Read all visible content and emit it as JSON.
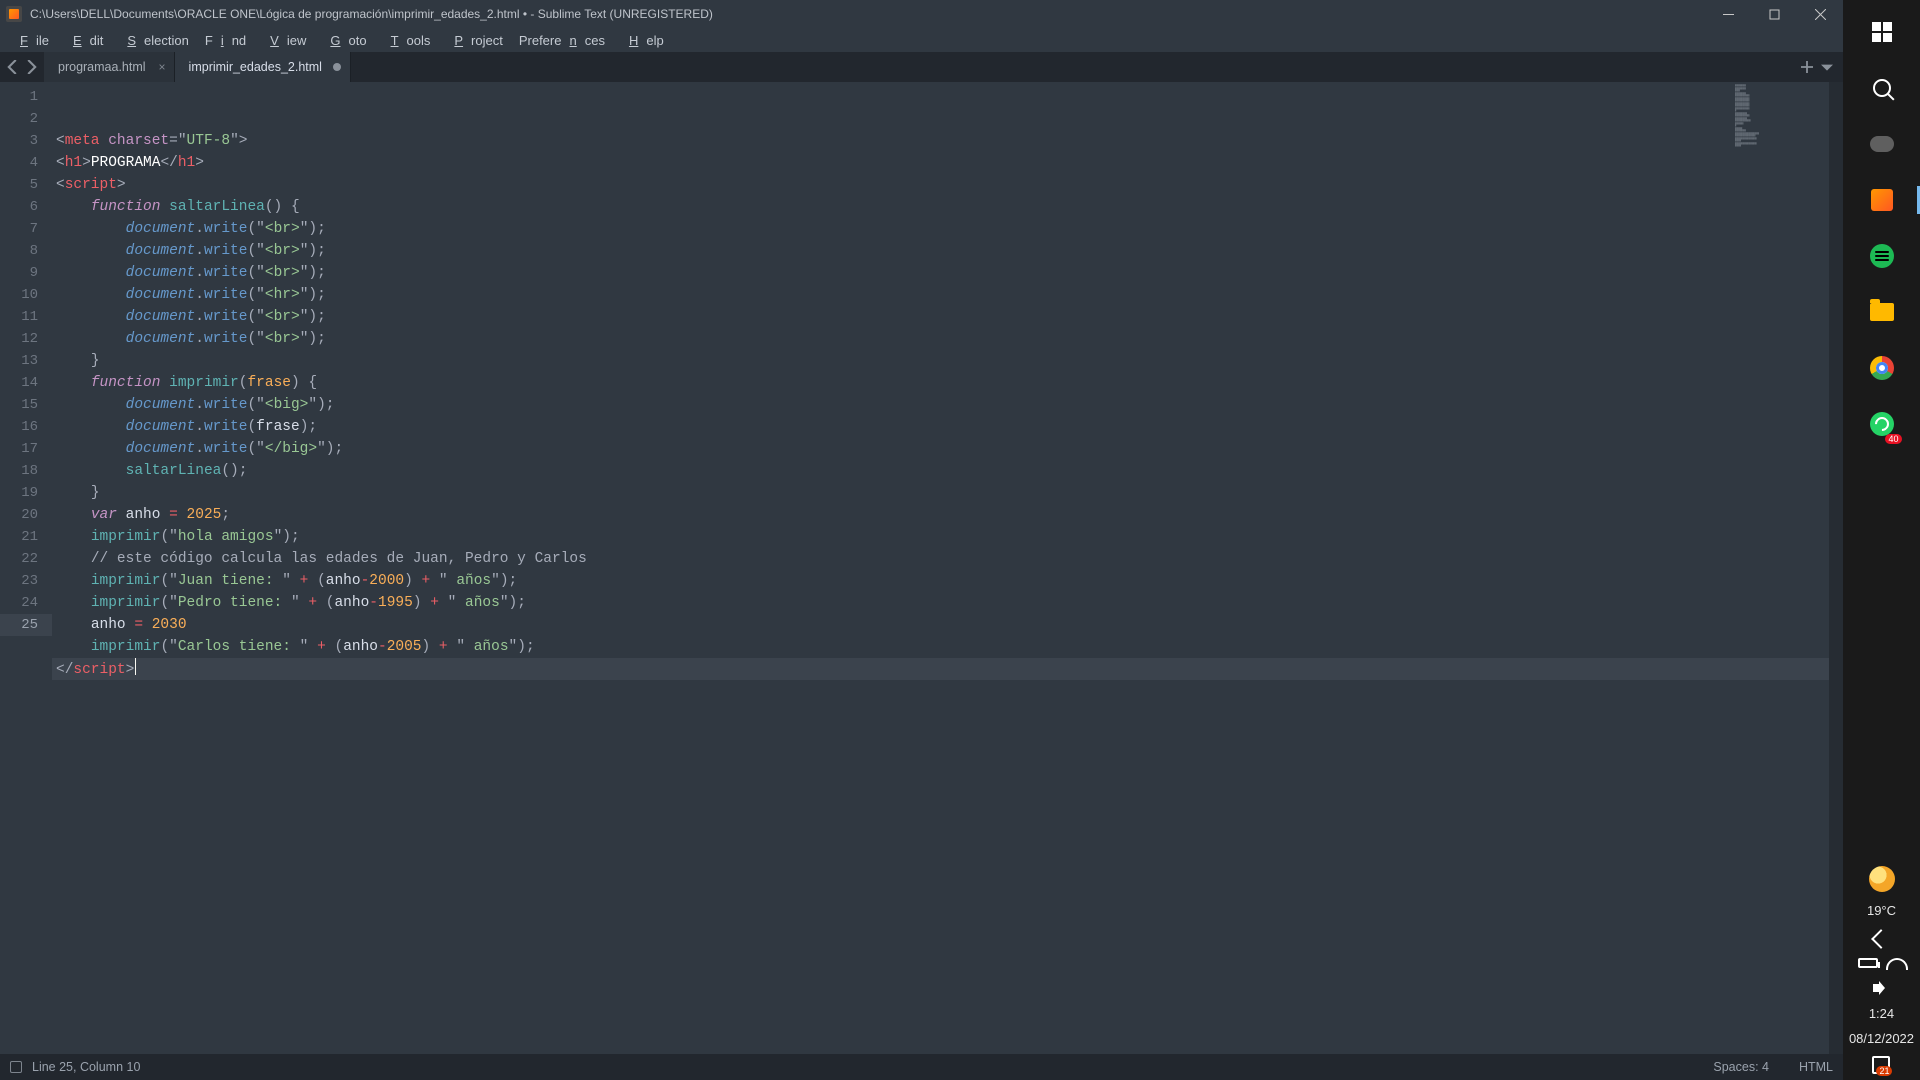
{
  "window": {
    "title": "C:\\Users\\DELL\\Documents\\ORACLE ONE\\Lógica de programación\\imprimir_edades_2.html • - Sublime Text (UNREGISTERED)"
  },
  "menu": [
    "File",
    "Edit",
    "Selection",
    "Find",
    "View",
    "Goto",
    "Tools",
    "Project",
    "Preferences",
    "Help"
  ],
  "tabs": [
    {
      "label": "programaa.html",
      "dirty": false,
      "active": false
    },
    {
      "label": "imprimir_edades_2.html",
      "dirty": true,
      "active": true
    }
  ],
  "status": {
    "position": "Line 25, Column 10",
    "spaces": "Spaces: 4",
    "syntax": "HTML"
  },
  "taskbar": {
    "weather_temp": "19°C",
    "time": "1:24",
    "date": "08/12/2022",
    "whatsapp_badge": "40",
    "notif_badge": "21"
  },
  "code": {
    "total_lines": 25,
    "current_line": 25,
    "lines": [
      {
        "n": 1,
        "html": "<span class='punc'>&lt;</span><span class='tag'>meta</span> <span class='attr'>charset</span><span class='punc'>=</span><span class='punc'>\"</span><span class='val'>UTF-8</span><span class='punc'>\"</span><span class='punc'>&gt;</span>"
      },
      {
        "n": 2,
        "html": "<span class='punc'>&lt;</span><span class='tag'>h1</span><span class='punc'>&gt;</span><span class='white'>PROGRAMA</span><span class='punc'>&lt;/</span><span class='tag'>h1</span><span class='punc'>&gt;</span>"
      },
      {
        "n": 3,
        "html": "<span class='punc'>&lt;</span><span class='tag'>script</span><span class='punc'>&gt;</span>"
      },
      {
        "n": 4,
        "html": "    <span class='kw'>function</span> <span class='fn'>saltarLinea</span><span class='punc'>() {</span>"
      },
      {
        "n": 5,
        "html": "        <span class='obj'>document</span><span class='punc'>.</span><span class='meth'>write</span><span class='punc'>(</span><span class='punc'>\"</span><span class='val'>&lt;br&gt;</span><span class='punc'>\"</span><span class='punc'>);</span>"
      },
      {
        "n": 6,
        "html": "        <span class='obj'>document</span><span class='punc'>.</span><span class='meth'>write</span><span class='punc'>(</span><span class='punc'>\"</span><span class='val'>&lt;br&gt;</span><span class='punc'>\"</span><span class='punc'>);</span>"
      },
      {
        "n": 7,
        "html": "        <span class='obj'>document</span><span class='punc'>.</span><span class='meth'>write</span><span class='punc'>(</span><span class='punc'>\"</span><span class='val'>&lt;br&gt;</span><span class='punc'>\"</span><span class='punc'>);</span>"
      },
      {
        "n": 8,
        "html": "        <span class='obj'>document</span><span class='punc'>.</span><span class='meth'>write</span><span class='punc'>(</span><span class='punc'>\"</span><span class='val'>&lt;hr&gt;</span><span class='punc'>\"</span><span class='punc'>);</span>"
      },
      {
        "n": 9,
        "html": "        <span class='obj'>document</span><span class='punc'>.</span><span class='meth'>write</span><span class='punc'>(</span><span class='punc'>\"</span><span class='val'>&lt;br&gt;</span><span class='punc'>\"</span><span class='punc'>);</span>"
      },
      {
        "n": 10,
        "html": "        <span class='obj'>document</span><span class='punc'>.</span><span class='meth'>write</span><span class='punc'>(</span><span class='punc'>\"</span><span class='val'>&lt;br&gt;</span><span class='punc'>\"</span><span class='punc'>);</span>"
      },
      {
        "n": 11,
        "html": "    <span class='punc'>}</span>"
      },
      {
        "n": 12,
        "html": "    <span class='kw'>function</span> <span class='fn'>imprimir</span><span class='punc'>(</span><span class='num'>frase</span><span class='punc'>) {</span>"
      },
      {
        "n": 13,
        "html": "        <span class='obj'>document</span><span class='punc'>.</span><span class='meth'>write</span><span class='punc'>(</span><span class='punc'>\"</span><span class='val'>&lt;big&gt;</span><span class='punc'>\"</span><span class='punc'>);</span>"
      },
      {
        "n": 14,
        "html": "        <span class='obj'>document</span><span class='punc'>.</span><span class='meth'>write</span><span class='punc'>(</span><span class='id'>frase</span><span class='punc'>);</span>"
      },
      {
        "n": 15,
        "html": "        <span class='obj'>document</span><span class='punc'>.</span><span class='meth'>write</span><span class='punc'>(</span><span class='punc'>\"</span><span class='val'>&lt;/big&gt;</span><span class='punc'>\"</span><span class='punc'>);</span>"
      },
      {
        "n": 16,
        "html": "        <span class='fn'>saltarLinea</span><span class='punc'>();</span>"
      },
      {
        "n": 17,
        "html": "    <span class='punc'>}</span>"
      },
      {
        "n": 18,
        "html": "    <span class='kw'>var</span> <span class='id'>anho</span> <span class='op'>=</span> <span class='num'>2025</span><span class='punc'>;</span>"
      },
      {
        "n": 19,
        "html": "    <span class='fn'>imprimir</span><span class='punc'>(</span><span class='punc'>\"</span><span class='val'>hola amigos</span><span class='punc'>\"</span><span class='punc'>);</span>"
      },
      {
        "n": 20,
        "html": "    <span class='cmt'>// este código calcula las edades de Juan, Pedro y Carlos</span>"
      },
      {
        "n": 21,
        "html": "    <span class='fn'>imprimir</span><span class='punc'>(</span><span class='punc'>\"</span><span class='val'>Juan tiene: </span><span class='punc'>\"</span> <span class='op'>+</span> <span class='punc'>(</span><span class='id'>anho</span><span class='op'>-</span><span class='num'>2000</span><span class='punc'>)</span> <span class='op'>+</span> <span class='punc'>\"</span><span class='val'> años</span><span class='punc'>\"</span><span class='punc'>);</span>"
      },
      {
        "n": 22,
        "html": "    <span class='fn'>imprimir</span><span class='punc'>(</span><span class='punc'>\"</span><span class='val'>Pedro tiene: </span><span class='punc'>\"</span> <span class='op'>+</span> <span class='punc'>(</span><span class='id'>anho</span><span class='op'>-</span><span class='num'>1995</span><span class='punc'>)</span> <span class='op'>+</span> <span class='punc'>\"</span><span class='val'> años</span><span class='punc'>\"</span><span class='punc'>);</span>"
      },
      {
        "n": 23,
        "html": "    <span class='id'>anho</span> <span class='op'>=</span> <span class='num'>2030</span>"
      },
      {
        "n": 24,
        "html": "    <span class='fn'>imprimir</span><span class='punc'>(</span><span class='punc'>\"</span><span class='val'>Carlos tiene: </span><span class='punc'>\"</span> <span class='op'>+</span> <span class='punc'>(</span><span class='id'>anho</span><span class='op'>-</span><span class='num'>2005</span><span class='punc'>)</span> <span class='op'>+</span> <span class='punc'>\"</span><span class='val'> años</span><span class='punc'>\"</span><span class='punc'>);</span>"
      },
      {
        "n": 25,
        "html": "<span class='punc'>&lt;/</span><span class='tag'>script</span><span class='punc'>&gt;</span><span class='cursor'></span>"
      }
    ]
  }
}
